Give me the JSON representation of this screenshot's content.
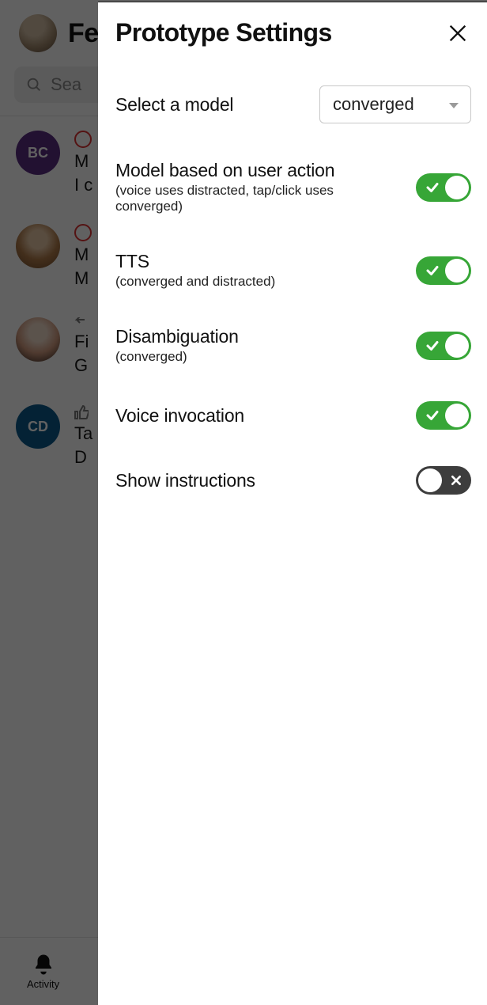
{
  "background": {
    "feed_title": "Fe",
    "search_placeholder": "Sea",
    "items": [
      {
        "avatar_initials": "BC",
        "line1": "M",
        "line2": "I c"
      },
      {
        "avatar_initials": "",
        "line1": "M",
        "line2": "M"
      },
      {
        "avatar_initials": "",
        "line1": "Fi",
        "line2": "G"
      },
      {
        "avatar_initials": "CD",
        "line1": "Ta",
        "line2": "D"
      }
    ],
    "nav": {
      "activity_label": "Activity"
    }
  },
  "panel": {
    "title": "Prototype Settings",
    "model_select": {
      "label": "Select a model",
      "value": "converged"
    },
    "settings": [
      {
        "label": "Model based on user action",
        "sublabel": "(voice uses distracted, tap/click uses converged)",
        "enabled": true
      },
      {
        "label": "TTS",
        "sublabel": "(converged and distracted)",
        "enabled": true
      },
      {
        "label": "Disambiguation",
        "sublabel": "(converged)",
        "enabled": true
      },
      {
        "label": "Voice invocation",
        "sublabel": "",
        "enabled": true
      },
      {
        "label": "Show instructions",
        "sublabel": "",
        "enabled": false
      }
    ]
  }
}
